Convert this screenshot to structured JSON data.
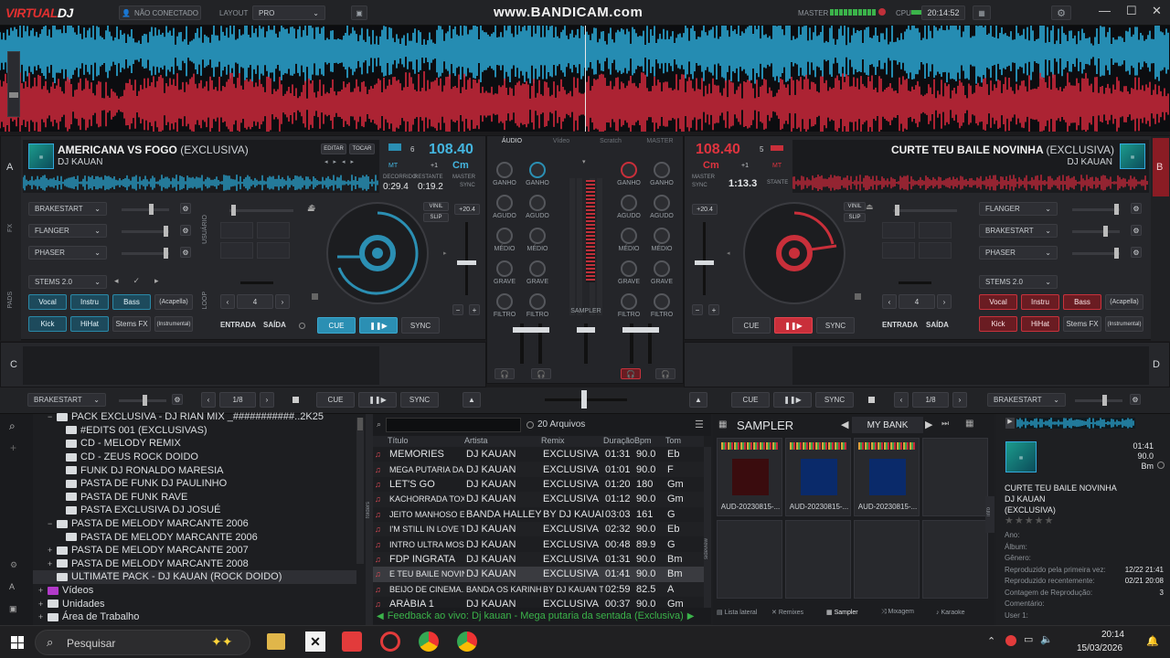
{
  "topbar": {
    "logo_a": "VIRTUAL",
    "logo_b": "DJ",
    "connection": "NÃO CONECTADO",
    "layout_label": "LAYOUT",
    "layout_value": "PRO",
    "watermark": "www.BANDICAM.com",
    "master_label": "MASTER",
    "cpu_label": "CPU",
    "clock": "20:14:52"
  },
  "deckA": {
    "letter": "A",
    "title": "AMERICANA VS FOGO",
    "title_suffix": "(EXCLUSIVA)",
    "artist": "DJ KAUAN",
    "edit": "EDITAR",
    "play_btn": "TOCAR",
    "bpm": "108.40",
    "key": "Cm",
    "mt": "MT",
    "pitch_offset": "+1",
    "beat_num": "6",
    "elapsed_label": "DECORRIDO",
    "remaining_label": "RESTANTE",
    "elapsed": "0:29.4",
    "remaining": "0:19.2",
    "master": "MASTER",
    "sync_label": "SYNC",
    "fx": [
      "BRAKESTART",
      "FLANGER",
      "PHASER"
    ],
    "stems": "STEMS 2.0",
    "stem_pads": [
      "Vocal",
      "Instru",
      "Bass",
      "(Acapella)",
      "Kick",
      "HiHat",
      "Stems FX",
      "(Instrumental)"
    ],
    "vinil": "VINIL",
    "slip": "SLIP",
    "pitch": "+20.4",
    "loop_value": "4",
    "entrada": "ENTRADA",
    "saida": "SAÍDA",
    "cue": "CUE",
    "sync": "SYNC",
    "side_fx": "FX",
    "side_pads": "PADS",
    "side_user": "USUÁRIO",
    "side_loop": "LOOP"
  },
  "deckB": {
    "letter": "B",
    "title": "CURTE TEU BAILE NOVINHA",
    "title_suffix": "(EXCLUSIVA)",
    "artist": "DJ KAUAN",
    "bpm": "108.40",
    "key": "Cm",
    "mt": "MT",
    "pitch_offset": "+1",
    "beat_num": "5",
    "elapsed": "1:13.3",
    "remaining_label": "STANTE",
    "master": "MASTER",
    "sync_label": "SYNC",
    "fx": [
      "FLANGER",
      "BRAKESTART",
      "PHASER"
    ],
    "stems": "STEMS 2.0",
    "stem_pads": [
      "Vocal",
      "Instru",
      "Bass",
      "(Acapella)",
      "Kick",
      "HiHat",
      "Stems FX",
      "(Instrumental)"
    ],
    "vinil": "VINIL",
    "slip": "SLIP",
    "pitch": "+20.4",
    "loop_value": "4",
    "entrada": "ENTRADA",
    "saida": "SAÍDA",
    "cue": "CUE",
    "sync": "SYNC"
  },
  "mixer": {
    "tabs": [
      "ÁUDIO",
      "Vídeo",
      "Scratch",
      "MASTER"
    ],
    "knob_rows": [
      "GANHO",
      "AGUDO",
      "MÉDIO",
      "GRAVE",
      "FILTRO"
    ],
    "sampler": "SAMPLER"
  },
  "deckC": {
    "letter": "C",
    "fx": "BRAKESTART",
    "loop": "1/8",
    "cue": "CUE",
    "sync": "SYNC"
  },
  "deckD": {
    "letter": "D",
    "fx": "BRAKESTART",
    "loop": "1/8",
    "cue": "CUE",
    "sync": "SYNC"
  },
  "browser": {
    "tree": [
      {
        "label": "PACK EXCLUSIVA - DJ RIAN MIX _###########..2K25",
        "indent": 1,
        "toggle": "−"
      },
      {
        "label": "#EDITS 001 (EXCLUSIVAS)",
        "indent": 2,
        "toggle": ""
      },
      {
        "label": "CD - MELODY REMIX",
        "indent": 2,
        "toggle": ""
      },
      {
        "label": "CD - ZEUS ROCK DOIDO",
        "indent": 2,
        "toggle": ""
      },
      {
        "label": "FUNK DJ RONALDO MARESIA",
        "indent": 2,
        "toggle": ""
      },
      {
        "label": "PASTA DE FUNK DJ PAULINHO",
        "indent": 2,
        "toggle": ""
      },
      {
        "label": "PASTA DE FUNK RAVE",
        "indent": 2,
        "toggle": ""
      },
      {
        "label": "PASTA EXCLUSIVA DJ JOSUÉ",
        "indent": 2,
        "toggle": ""
      },
      {
        "label": "PASTA DE MELODY MARCANTE 2006",
        "indent": 1,
        "toggle": "−"
      },
      {
        "label": "PASTA DE MELODY MARCANTE 2006",
        "indent": 2,
        "toggle": ""
      },
      {
        "label": "PASTA DE MELODY MARCANTE 2007",
        "indent": 1,
        "toggle": "+"
      },
      {
        "label": "PASTA DE MELODY MARCANTE 2008",
        "indent": 1,
        "toggle": "+"
      },
      {
        "label": "ULTIMATE PACK - DJ KAUAN (ROCK DOIDO)",
        "indent": 1,
        "toggle": ""
      },
      {
        "label": "Vídeos",
        "indent": 0,
        "toggle": "+"
      },
      {
        "label": "Unidades",
        "indent": 0,
        "toggle": "+"
      },
      {
        "label": "Área de Trabalho",
        "indent": 0,
        "toggle": "+"
      }
    ],
    "file_count": "20 Arquivos",
    "columns": [
      "Título",
      "Artista",
      "Remix",
      "Duração",
      "Bpm",
      "Tom"
    ],
    "rows": [
      [
        "MEMORIES",
        "DJ KAUAN",
        "EXCLUSIVA",
        "01:31",
        "90.0",
        "Eb"
      ],
      [
        "MEGA PUTARIA DA...",
        "DJ KAUAN",
        "EXCLUSIVA",
        "01:01",
        "90.0",
        "F"
      ],
      [
        "LET'S GO",
        "DJ KAUAN",
        "EXCLUSIVA",
        "01:20",
        "180",
        "Gm"
      ],
      [
        "KACHORRADA TOXIC",
        "DJ KAUAN",
        "EXCLUSIVA",
        "01:12",
        "90.0",
        "Gm"
      ],
      [
        "JEITO MANHOSO E...",
        "BANDA HALLEY",
        "BY DJ KAUAN",
        "03:03",
        "161",
        "G"
      ],
      [
        "I'M STILL IN LOVE T...",
        "DJ KAUAN",
        "EXCLUSIVA",
        "02:32",
        "90.0",
        "Eb"
      ],
      [
        "INTRO ULTRA MOS...",
        "DJ KAUAN",
        "EXCLUSIVA",
        "00:48",
        "89.9",
        "G"
      ],
      [
        "FDP INGRATA",
        "DJ KAUAN",
        "EXCLUSIVA",
        "01:31",
        "90.0",
        "Bm"
      ],
      [
        "E TEU BAILE NOVINH",
        "DJ KAUAN",
        "EXCLUSIVA",
        "01:41",
        "90.0",
        "Bm"
      ],
      [
        "BEIJO DE CINEMA...",
        "BANDA OS KARINHAS",
        "BY DJ KAUAN T...",
        "02:59",
        "82.5",
        "A"
      ],
      [
        "ARÁBIA 1",
        "DJ KAUAN",
        "EXCLUSIVA",
        "00:37",
        "90.0",
        "Gm"
      ]
    ],
    "feedback": "Feedback ao vivo: Dj kauan - Mega putaria da sentada (Exclusiva)",
    "side_folders": "folders",
    "side_sideview": "sideview",
    "sampler_title": "SAMPLER",
    "bank": "MY BANK",
    "samples": [
      "AUD-20230815-...",
      "AUD-20230815-...",
      "AUD-20230815-..."
    ],
    "bottom_tabs": [
      "Lista lateral",
      "Remixes",
      "Sampler",
      "Mixagem",
      "Karaoke"
    ],
    "info_tab": "info"
  },
  "info": {
    "time": "01:41",
    "bpm": "90.0",
    "key": "Bm",
    "title": "CURTE TEU BAILE NOVINHA",
    "artist": "DJ KAUAN",
    "remix": "(EXCLUSIVA)",
    "fields": [
      {
        "label": "Ano:",
        "value": ""
      },
      {
        "label": "Álbum:",
        "value": ""
      },
      {
        "label": "Gênero:",
        "value": ""
      },
      {
        "label": "Reproduzido pela primeira vez:",
        "value": "12/22 21:41"
      },
      {
        "label": "Reproduzido recentemente:",
        "value": "02/21 20:08"
      },
      {
        "label": "Contagem de Reprodução:",
        "value": "3"
      },
      {
        "label": "Comentário:",
        "value": ""
      },
      {
        "label": "User 1:",
        "value": ""
      }
    ]
  },
  "taskbar": {
    "search": "Pesquisar",
    "time": "20:14",
    "date": "15/03/2026"
  }
}
